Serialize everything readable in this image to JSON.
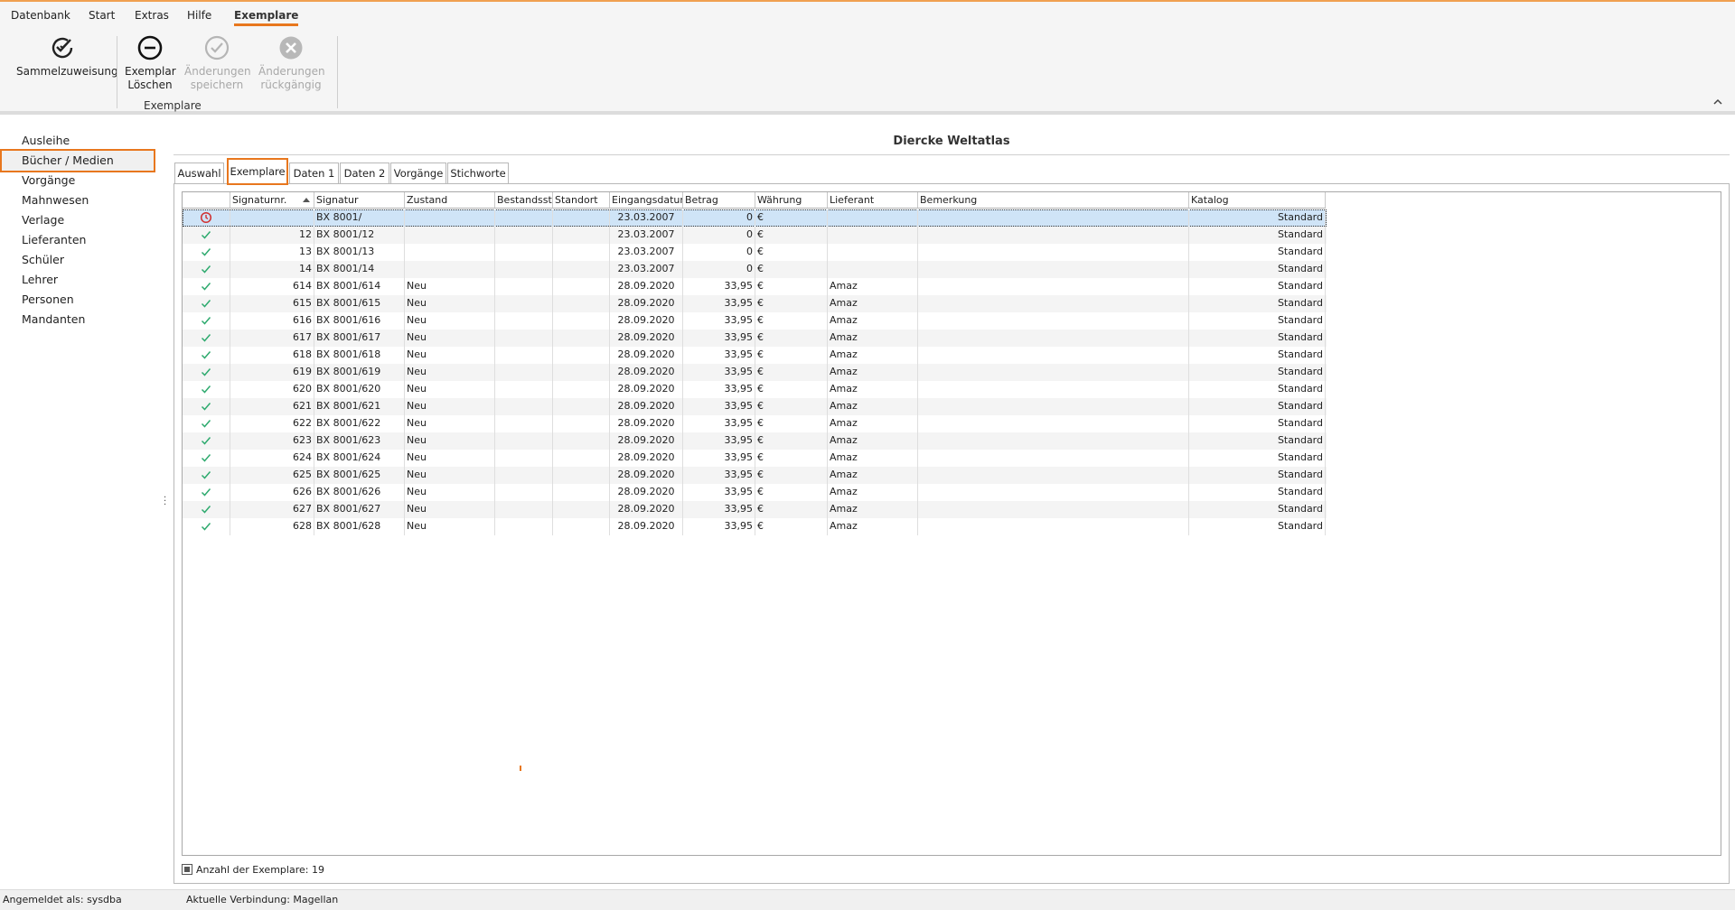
{
  "menu": {
    "items": [
      "Datenbank",
      "Start",
      "Extras",
      "Hilfe",
      "Exemplare"
    ],
    "active": "Exemplare"
  },
  "ribbon": {
    "buttons": {
      "sammelzuweisung": "Sammelzuweisung",
      "loeschen_l1": "Exemplar",
      "loeschen_l2": "Löschen",
      "speichern_l1": "Änderungen",
      "speichern_l2": "speichern",
      "rueck_l1": "Änderungen",
      "rueck_l2": "rückgängig"
    },
    "group_label": "Exemplare",
    "collapse_icon": "chevron-up-icon"
  },
  "sidebar": {
    "items": [
      "Ausleihe",
      "Bücher / Medien",
      "Vorgänge",
      "Mahnwesen",
      "Verlage",
      "Lieferanten",
      "Schüler",
      "Lehrer",
      "Personen",
      "Mandanten"
    ],
    "selected": "Bücher / Medien"
  },
  "main": {
    "title": "Diercke Weltatlas",
    "tabs": [
      "Auswahl",
      "Exemplare",
      "Daten 1",
      "Daten 2",
      "Vorgänge",
      "Stichworte"
    ],
    "active_tab": "Exemplare"
  },
  "grid": {
    "columns": [
      "",
      "Signaturnr.",
      "Signatur",
      "Zustand",
      "Bestandssta",
      "Standort",
      "Eingangsdatum",
      "Betrag",
      "Währung",
      "Lieferant",
      "Bemerkung",
      "Katalog"
    ],
    "sort_column": "Signaturnr.",
    "sort_direction": "ascending",
    "rows": [
      {
        "status": "clock",
        "nr": "",
        "signatur": "BX 8001/",
        "zustand": "",
        "bestand": "",
        "standort": "",
        "datum": "23.03.2007",
        "betrag": "0",
        "waehrung": "€",
        "lieferant": "",
        "bemerkung": "",
        "katalog": "Standard"
      },
      {
        "status": "check",
        "nr": "12",
        "signatur": "BX 8001/12",
        "zustand": "",
        "bestand": "",
        "standort": "",
        "datum": "23.03.2007",
        "betrag": "0",
        "waehrung": "€",
        "lieferant": "",
        "bemerkung": "",
        "katalog": "Standard"
      },
      {
        "status": "check",
        "nr": "13",
        "signatur": "BX 8001/13",
        "zustand": "",
        "bestand": "",
        "standort": "",
        "datum": "23.03.2007",
        "betrag": "0",
        "waehrung": "€",
        "lieferant": "",
        "bemerkung": "",
        "katalog": "Standard"
      },
      {
        "status": "check",
        "nr": "14",
        "signatur": "BX 8001/14",
        "zustand": "",
        "bestand": "",
        "standort": "",
        "datum": "23.03.2007",
        "betrag": "0",
        "waehrung": "€",
        "lieferant": "",
        "bemerkung": "",
        "katalog": "Standard"
      },
      {
        "status": "check",
        "nr": "614",
        "signatur": "BX 8001/614",
        "zustand": "Neu",
        "bestand": "",
        "standort": "",
        "datum": "28.09.2020",
        "betrag": "33,95",
        "waehrung": "€",
        "lieferant": "Amaz",
        "bemerkung": "",
        "katalog": "Standard"
      },
      {
        "status": "check",
        "nr": "615",
        "signatur": "BX 8001/615",
        "zustand": "Neu",
        "bestand": "",
        "standort": "",
        "datum": "28.09.2020",
        "betrag": "33,95",
        "waehrung": "€",
        "lieferant": "Amaz",
        "bemerkung": "",
        "katalog": "Standard"
      },
      {
        "status": "check",
        "nr": "616",
        "signatur": "BX 8001/616",
        "zustand": "Neu",
        "bestand": "",
        "standort": "",
        "datum": "28.09.2020",
        "betrag": "33,95",
        "waehrung": "€",
        "lieferant": "Amaz",
        "bemerkung": "",
        "katalog": "Standard"
      },
      {
        "status": "check",
        "nr": "617",
        "signatur": "BX 8001/617",
        "zustand": "Neu",
        "bestand": "",
        "standort": "",
        "datum": "28.09.2020",
        "betrag": "33,95",
        "waehrung": "€",
        "lieferant": "Amaz",
        "bemerkung": "",
        "katalog": "Standard"
      },
      {
        "status": "check",
        "nr": "618",
        "signatur": "BX 8001/618",
        "zustand": "Neu",
        "bestand": "",
        "standort": "",
        "datum": "28.09.2020",
        "betrag": "33,95",
        "waehrung": "€",
        "lieferant": "Amaz",
        "bemerkung": "",
        "katalog": "Standard"
      },
      {
        "status": "check",
        "nr": "619",
        "signatur": "BX 8001/619",
        "zustand": "Neu",
        "bestand": "",
        "standort": "",
        "datum": "28.09.2020",
        "betrag": "33,95",
        "waehrung": "€",
        "lieferant": "Amaz",
        "bemerkung": "",
        "katalog": "Standard"
      },
      {
        "status": "check",
        "nr": "620",
        "signatur": "BX 8001/620",
        "zustand": "Neu",
        "bestand": "",
        "standort": "",
        "datum": "28.09.2020",
        "betrag": "33,95",
        "waehrung": "€",
        "lieferant": "Amaz",
        "bemerkung": "",
        "katalog": "Standard"
      },
      {
        "status": "check",
        "nr": "621",
        "signatur": "BX 8001/621",
        "zustand": "Neu",
        "bestand": "",
        "standort": "",
        "datum": "28.09.2020",
        "betrag": "33,95",
        "waehrung": "€",
        "lieferant": "Amaz",
        "bemerkung": "",
        "katalog": "Standard"
      },
      {
        "status": "check",
        "nr": "622",
        "signatur": "BX 8001/622",
        "zustand": "Neu",
        "bestand": "",
        "standort": "",
        "datum": "28.09.2020",
        "betrag": "33,95",
        "waehrung": "€",
        "lieferant": "Amaz",
        "bemerkung": "",
        "katalog": "Standard"
      },
      {
        "status": "check",
        "nr": "623",
        "signatur": "BX 8001/623",
        "zustand": "Neu",
        "bestand": "",
        "standort": "",
        "datum": "28.09.2020",
        "betrag": "33,95",
        "waehrung": "€",
        "lieferant": "Amaz",
        "bemerkung": "",
        "katalog": "Standard"
      },
      {
        "status": "check",
        "nr": "624",
        "signatur": "BX 8001/624",
        "zustand": "Neu",
        "bestand": "",
        "standort": "",
        "datum": "28.09.2020",
        "betrag": "33,95",
        "waehrung": "€",
        "lieferant": "Amaz",
        "bemerkung": "",
        "katalog": "Standard"
      },
      {
        "status": "check",
        "nr": "625",
        "signatur": "BX 8001/625",
        "zustand": "Neu",
        "bestand": "",
        "standort": "",
        "datum": "28.09.2020",
        "betrag": "33,95",
        "waehrung": "€",
        "lieferant": "Amaz",
        "bemerkung": "",
        "katalog": "Standard"
      },
      {
        "status": "check",
        "nr": "626",
        "signatur": "BX 8001/626",
        "zustand": "Neu",
        "bestand": "",
        "standort": "",
        "datum": "28.09.2020",
        "betrag": "33,95",
        "waehrung": "€",
        "lieferant": "Amaz",
        "bemerkung": "",
        "katalog": "Standard"
      },
      {
        "status": "check",
        "nr": "627",
        "signatur": "BX 8001/627",
        "zustand": "Neu",
        "bestand": "",
        "standort": "",
        "datum": "28.09.2020",
        "betrag": "33,95",
        "waehrung": "€",
        "lieferant": "Amaz",
        "bemerkung": "",
        "katalog": "Standard"
      },
      {
        "status": "check",
        "nr": "628",
        "signatur": "BX 8001/628",
        "zustand": "Neu",
        "bestand": "",
        "standort": "",
        "datum": "28.09.2020",
        "betrag": "33,95",
        "waehrung": "€",
        "lieferant": "Amaz",
        "bemerkung": "",
        "katalog": "Standard"
      }
    ],
    "selected_row": 0,
    "footer": "Anzahl der Exemplare: 19"
  },
  "statusbar": {
    "user": "Angemeldet als: sysdba",
    "connection": "Aktuelle Verbindung: Magellan"
  },
  "colors": {
    "accent": "#e8771e",
    "check": "#2eaa6e",
    "clock": "#d03030",
    "selected_row": "#cfe4f7"
  }
}
